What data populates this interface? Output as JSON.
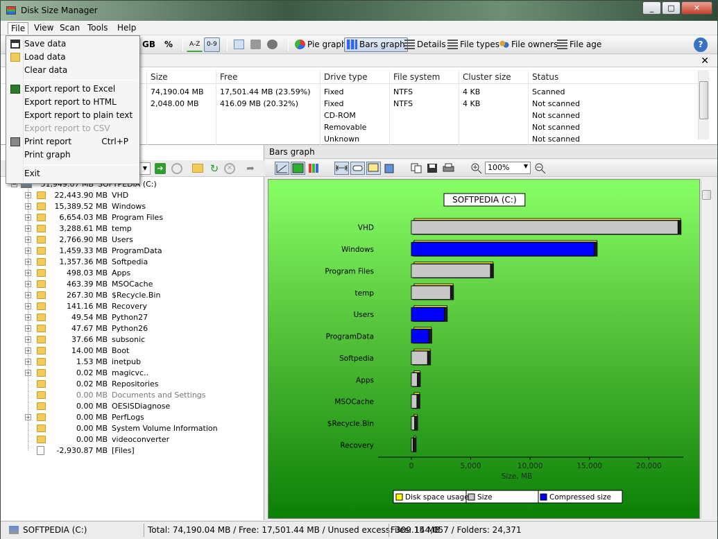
{
  "window": {
    "title": "Disk Size Manager",
    "min_label": "_",
    "max_label": "□",
    "close_label": "✕"
  },
  "menu": {
    "file": "File",
    "view": "View",
    "scan": "Scan",
    "tools": "Tools",
    "help": "Help"
  },
  "file_menu": {
    "save": "Save data",
    "load": "Load data",
    "clear": "Clear data",
    "export_excel": "Export report to Excel",
    "export_html": "Export report to HTML",
    "export_text": "Export report to plain text",
    "export_csv": "Export report to CSV",
    "print_report": "Print report",
    "print_shortcut": "Ctrl+P",
    "print_graph": "Print graph",
    "exit": "Exit"
  },
  "toolbar": {
    "gb": "GB",
    "pct": "%",
    "sort_az": "A-Z",
    "sort_09": "0-9",
    "pie": "Pie graph",
    "bars": "Bars graph",
    "details": "Details",
    "file_types": "File types",
    "file_owners": "File owners",
    "file_age": "File age",
    "help_btn": "?"
  },
  "drives": {
    "close": "✕",
    "columns": {
      "size": "Size",
      "free": "Free",
      "drive_type": "Drive type",
      "file_system": "File system",
      "cluster": "Cluster size",
      "status": "Status"
    },
    "rows": [
      {
        "size": "74,190.04 MB",
        "free": "17,501.44 MB (23.59%)",
        "type": "Fixed",
        "fs": "NTFS",
        "cluster": "4 KB",
        "status": "Scanned"
      },
      {
        "size": "2,048.00 MB",
        "free": "416.09 MB (20.32%)",
        "type": "Fixed",
        "fs": "NTFS",
        "cluster": "4 KB",
        "status": "Not scanned"
      },
      {
        "size": "",
        "free": "",
        "type": "CD-ROM",
        "fs": "",
        "cluster": "",
        "status": "Not scanned"
      },
      {
        "size": "",
        "free": "",
        "type": "Removable",
        "fs": "",
        "cluster": "",
        "status": "Not scanned"
      },
      {
        "size": "",
        "free": "",
        "type": "Unknown",
        "fs": "",
        "cluster": "",
        "status": "Not scanned"
      }
    ]
  },
  "tree": {
    "root": {
      "size": "51,949.07 MB",
      "name": "SOFTPEDIA (C:)"
    },
    "items": [
      {
        "size": "22,443.90 MB",
        "name": "VHD",
        "expandable": true,
        "grey": false
      },
      {
        "size": "15,389.52 MB",
        "name": "Windows",
        "expandable": true,
        "grey": false
      },
      {
        "size": "6,654.03 MB",
        "name": "Program Files",
        "expandable": true,
        "grey": false
      },
      {
        "size": "3,288.61 MB",
        "name": "temp",
        "expandable": true,
        "grey": false
      },
      {
        "size": "2,766.90 MB",
        "name": "Users",
        "expandable": true,
        "grey": false
      },
      {
        "size": "1,459.33 MB",
        "name": "ProgramData",
        "expandable": true,
        "grey": false
      },
      {
        "size": "1,357.36 MB",
        "name": "Softpedia",
        "expandable": true,
        "grey": false
      },
      {
        "size": "498.03 MB",
        "name": "Apps",
        "expandable": true,
        "grey": false
      },
      {
        "size": "463.39 MB",
        "name": "MSOCache",
        "expandable": true,
        "grey": false
      },
      {
        "size": "267.30 MB",
        "name": "$Recycle.Bin",
        "expandable": true,
        "grey": false
      },
      {
        "size": "141.16 MB",
        "name": "Recovery",
        "expandable": true,
        "grey": false
      },
      {
        "size": "49.54 MB",
        "name": "Python27",
        "expandable": true,
        "grey": false
      },
      {
        "size": "47.67 MB",
        "name": "Python26",
        "expandable": true,
        "grey": false
      },
      {
        "size": "37.66 MB",
        "name": "subsonic",
        "expandable": true,
        "grey": false
      },
      {
        "size": "14.00 MB",
        "name": "Boot",
        "expandable": true,
        "grey": false
      },
      {
        "size": "1.53 MB",
        "name": "inetpub",
        "expandable": true,
        "grey": false
      },
      {
        "size": "0.02 MB",
        "name": "magicvc..",
        "expandable": true,
        "grey": false
      },
      {
        "size": "0.02 MB",
        "name": "Repositories",
        "expandable": false,
        "grey": false
      },
      {
        "size": "0.00 MB",
        "name": "Documents and Settings",
        "expandable": false,
        "grey": true
      },
      {
        "size": "0.00 MB",
        "name": "OESISDiagnose",
        "expandable": false,
        "grey": false
      },
      {
        "size": "0.00 MB",
        "name": "PerfLogs",
        "expandable": true,
        "grey": false
      },
      {
        "size": "0.00 MB",
        "name": "System Volume Information",
        "expandable": false,
        "grey": false
      },
      {
        "size": "0.00 MB",
        "name": "videoconverter",
        "expandable": false,
        "grey": false
      },
      {
        "size": "-2,930.87 MB",
        "name": "[Files]",
        "expandable": false,
        "grey": false,
        "file": true
      }
    ]
  },
  "graph_panel": {
    "title": "Bars graph",
    "zoom": "100%"
  },
  "chart_data": {
    "type": "bar",
    "title": "SOFTPEDIA (C:)",
    "xlabel": "Size, MB",
    "xlim": [
      -2800,
      22900
    ],
    "xticks": [
      0,
      5000,
      10000,
      15000,
      20000
    ],
    "xtick_labels": [
      "0",
      "5,000",
      "10,000",
      "15,000",
      "20,000"
    ],
    "categories": [
      "VHD",
      "Windows",
      "Program Files",
      "temp",
      "Users",
      "ProgramData",
      "Softpedia",
      "Apps",
      "MSOCache",
      "$Recycle.Bin",
      "Recovery"
    ],
    "values": [
      22443.9,
      15389.52,
      6654.03,
      3288.61,
      2766.9,
      1459.33,
      1357.36,
      498.03,
      463.39,
      267.3,
      141.16
    ],
    "compressed": [
      false,
      true,
      false,
      false,
      true,
      true,
      false,
      false,
      false,
      false,
      false
    ],
    "legend": [
      {
        "name": "Disk space usage",
        "color": "#ffff00"
      },
      {
        "name": "Size",
        "color": "#c8c8c8"
      },
      {
        "name": "Compressed size",
        "color": "#0000ff"
      }
    ],
    "colors": {
      "size": "#c8c8c8",
      "compressed": "#0000ff",
      "usage": "#f4ec28",
      "shadow": "#1a1a1a"
    }
  },
  "status": {
    "drive": "SOFTPEDIA (C:)",
    "summary": "Total: 74,190.04 MB / Free: 17,501.44 MB / Unused excess: 309.15 MB",
    "files": "Files: 144,057 / Folders: 24,371"
  }
}
